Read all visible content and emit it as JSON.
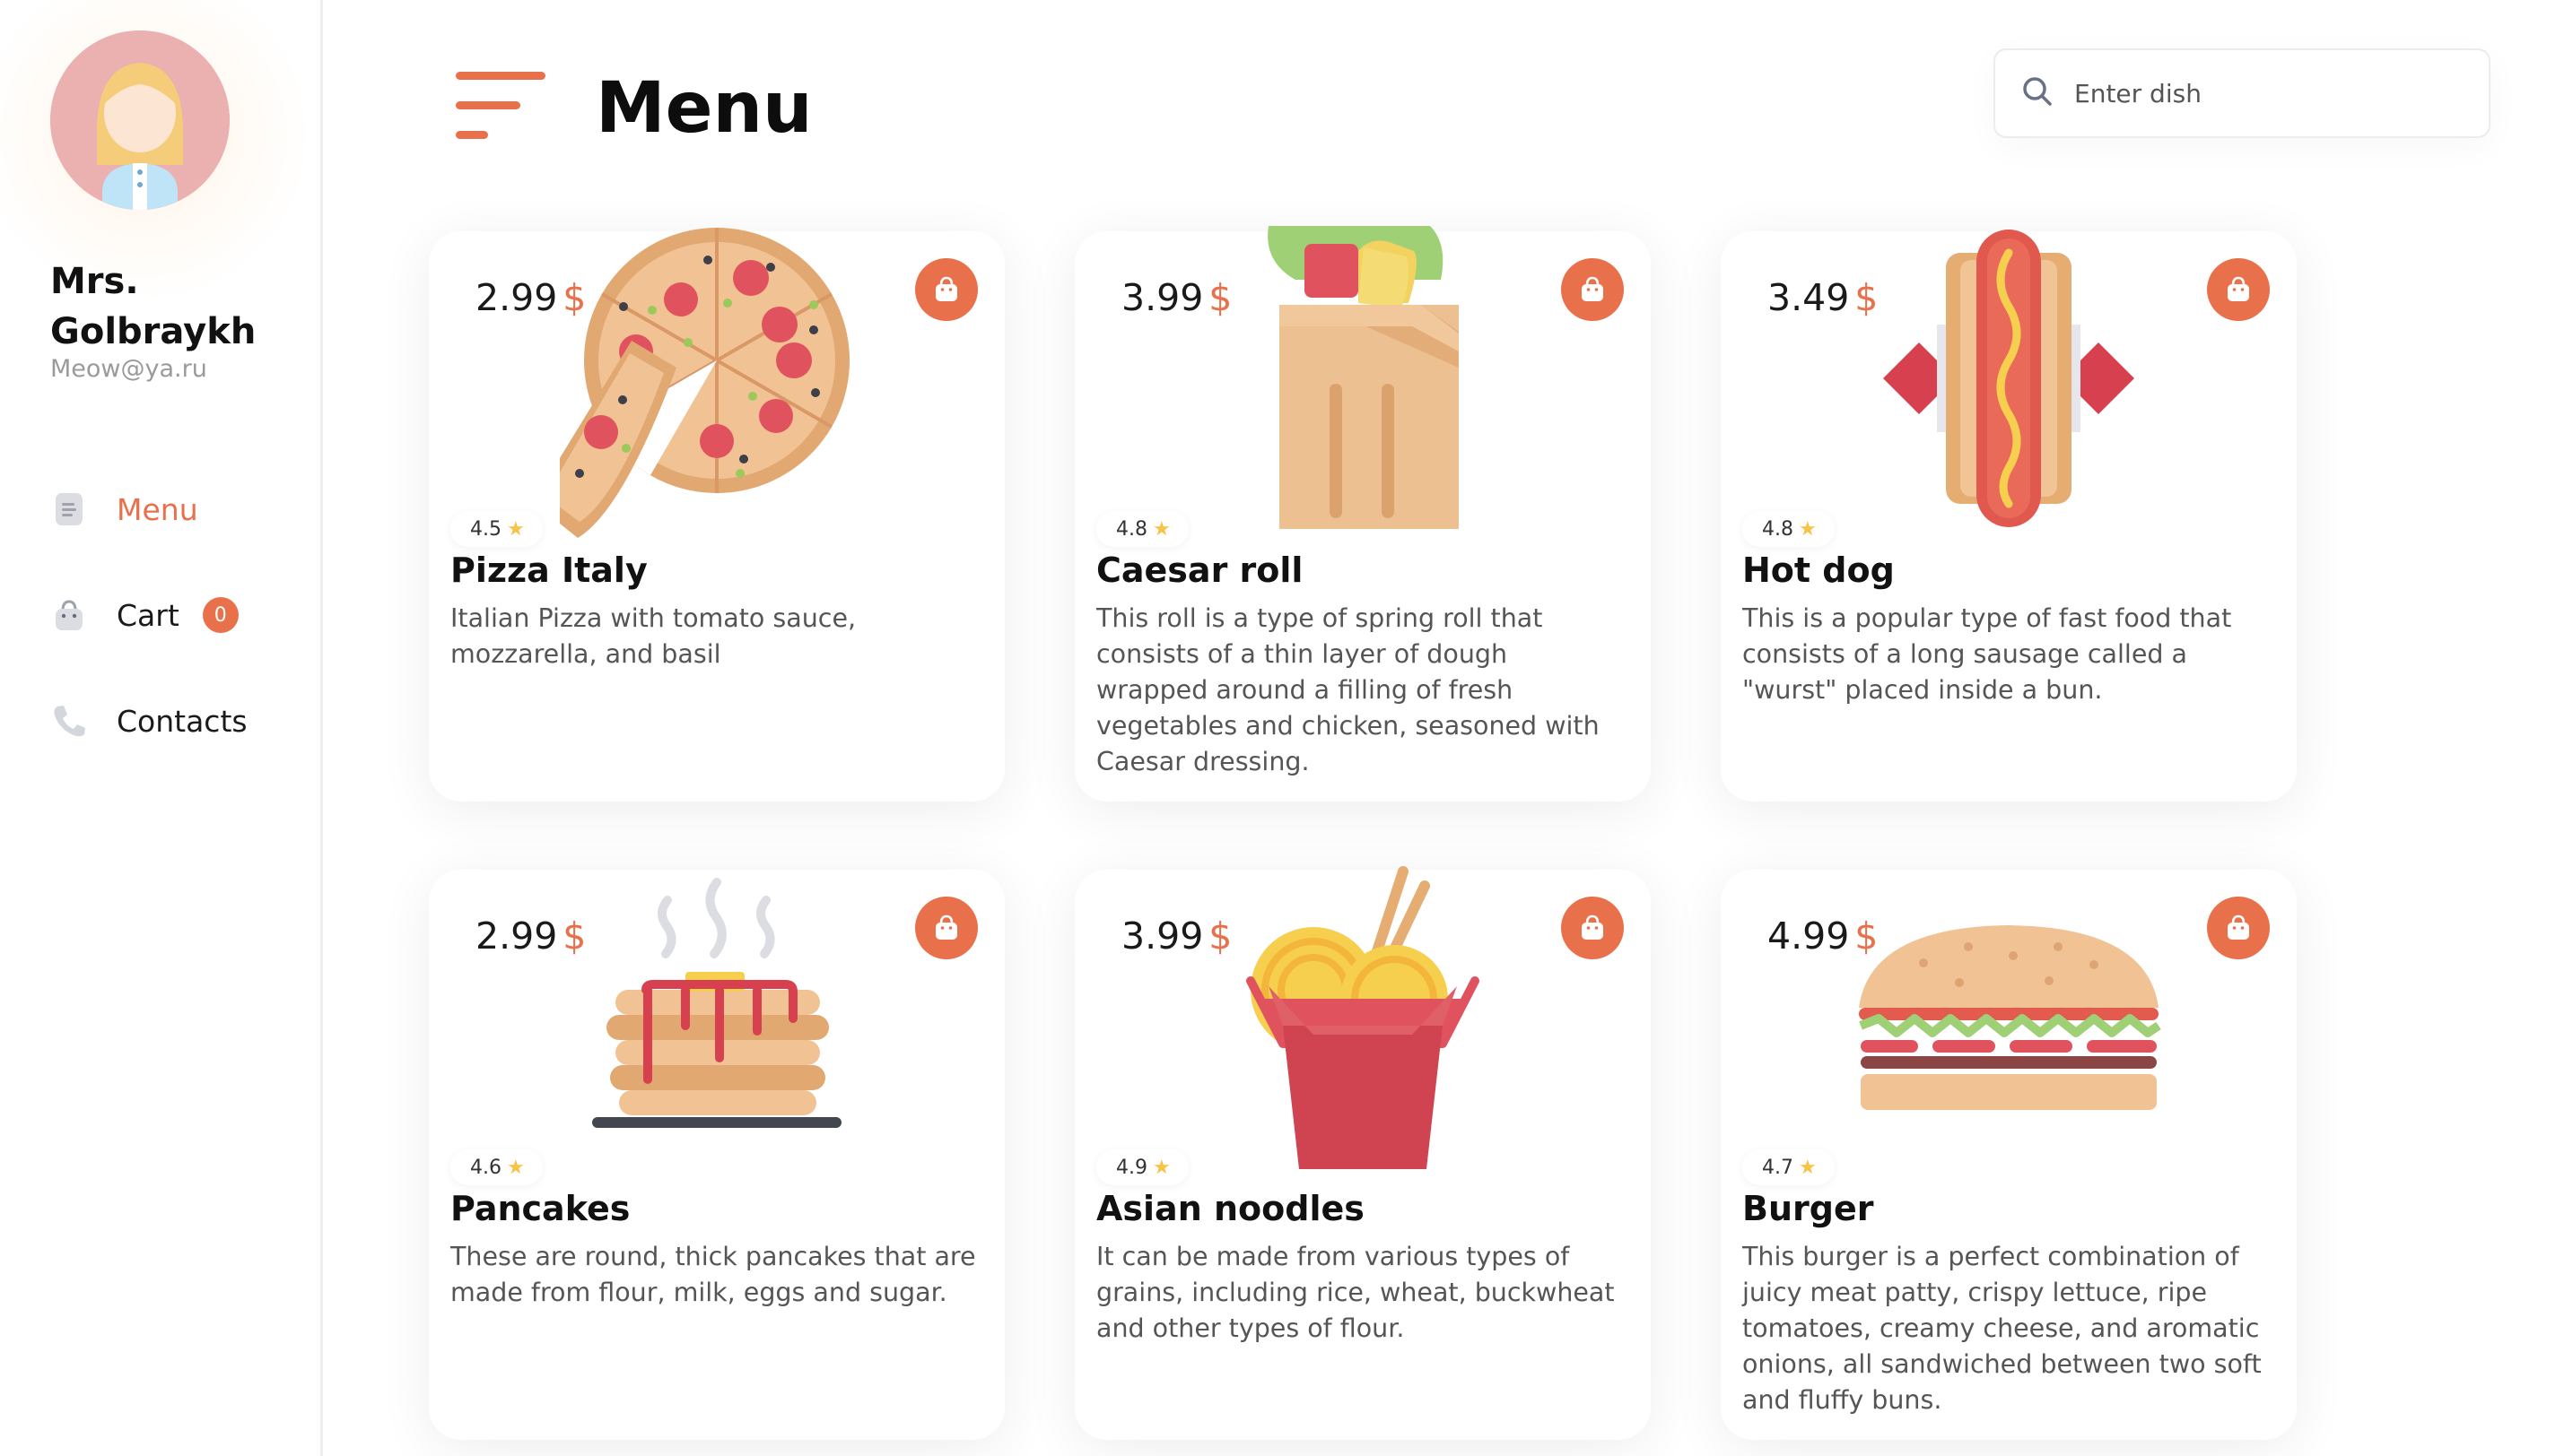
{
  "user": {
    "name": "Mrs. Golbraykh",
    "email": "Meow@ya.ru"
  },
  "nav": {
    "items": [
      {
        "label": "Menu",
        "icon": "menu-list-icon",
        "active": true
      },
      {
        "label": "Cart",
        "icon": "bag-icon",
        "badge": "0"
      },
      {
        "label": "Contacts",
        "icon": "phone-icon"
      }
    ]
  },
  "header": {
    "title": "Menu"
  },
  "search": {
    "placeholder": "Enter dish"
  },
  "colors": {
    "accent": "#e8704a",
    "star": "#f6c343",
    "text_muted": "#555555"
  },
  "dishes": [
    {
      "price": "2.99",
      "currency": "$",
      "rating": "4.5",
      "name": "Pizza Italy",
      "description": "Italian Pizza with tomato sauce, mozzarella, and basil",
      "image": "pizza-image"
    },
    {
      "price": "3.99",
      "currency": "$",
      "rating": "4.8",
      "name": "Caesar roll",
      "description": "This roll is a type of spring roll that consists of a thin layer of dough wrapped around a filling of fresh vegetables and chicken, seasoned with Caesar dressing.",
      "image": "wrap-image"
    },
    {
      "price": "3.49",
      "currency": "$",
      "rating": "4.8",
      "name": "Hot dog",
      "description": "This is a popular type of fast food that consists of a long sausage called a \"wurst\" placed inside a bun.",
      "image": "hotdog-image"
    },
    {
      "price": "2.99",
      "currency": "$",
      "rating": "4.6",
      "name": "Pancakes",
      "description": "These are round, thick pancakes that are made from flour, milk, eggs and sugar.",
      "image": "pancakes-image"
    },
    {
      "price": "3.99",
      "currency": "$",
      "rating": "4.9",
      "name": "Asian noodles",
      "description": "It can be made from various types of grains, including rice, wheat, buckwheat and other types of flour.",
      "image": "noodles-image"
    },
    {
      "price": "4.99",
      "currency": "$",
      "rating": "4.7",
      "name": "Burger",
      "description": "This burger is a perfect combination of juicy meat patty, crispy lettuce, ripe tomatoes, creamy cheese, and aromatic onions, all sandwiched between two soft and fluffy buns.",
      "image": "burger-image"
    }
  ]
}
